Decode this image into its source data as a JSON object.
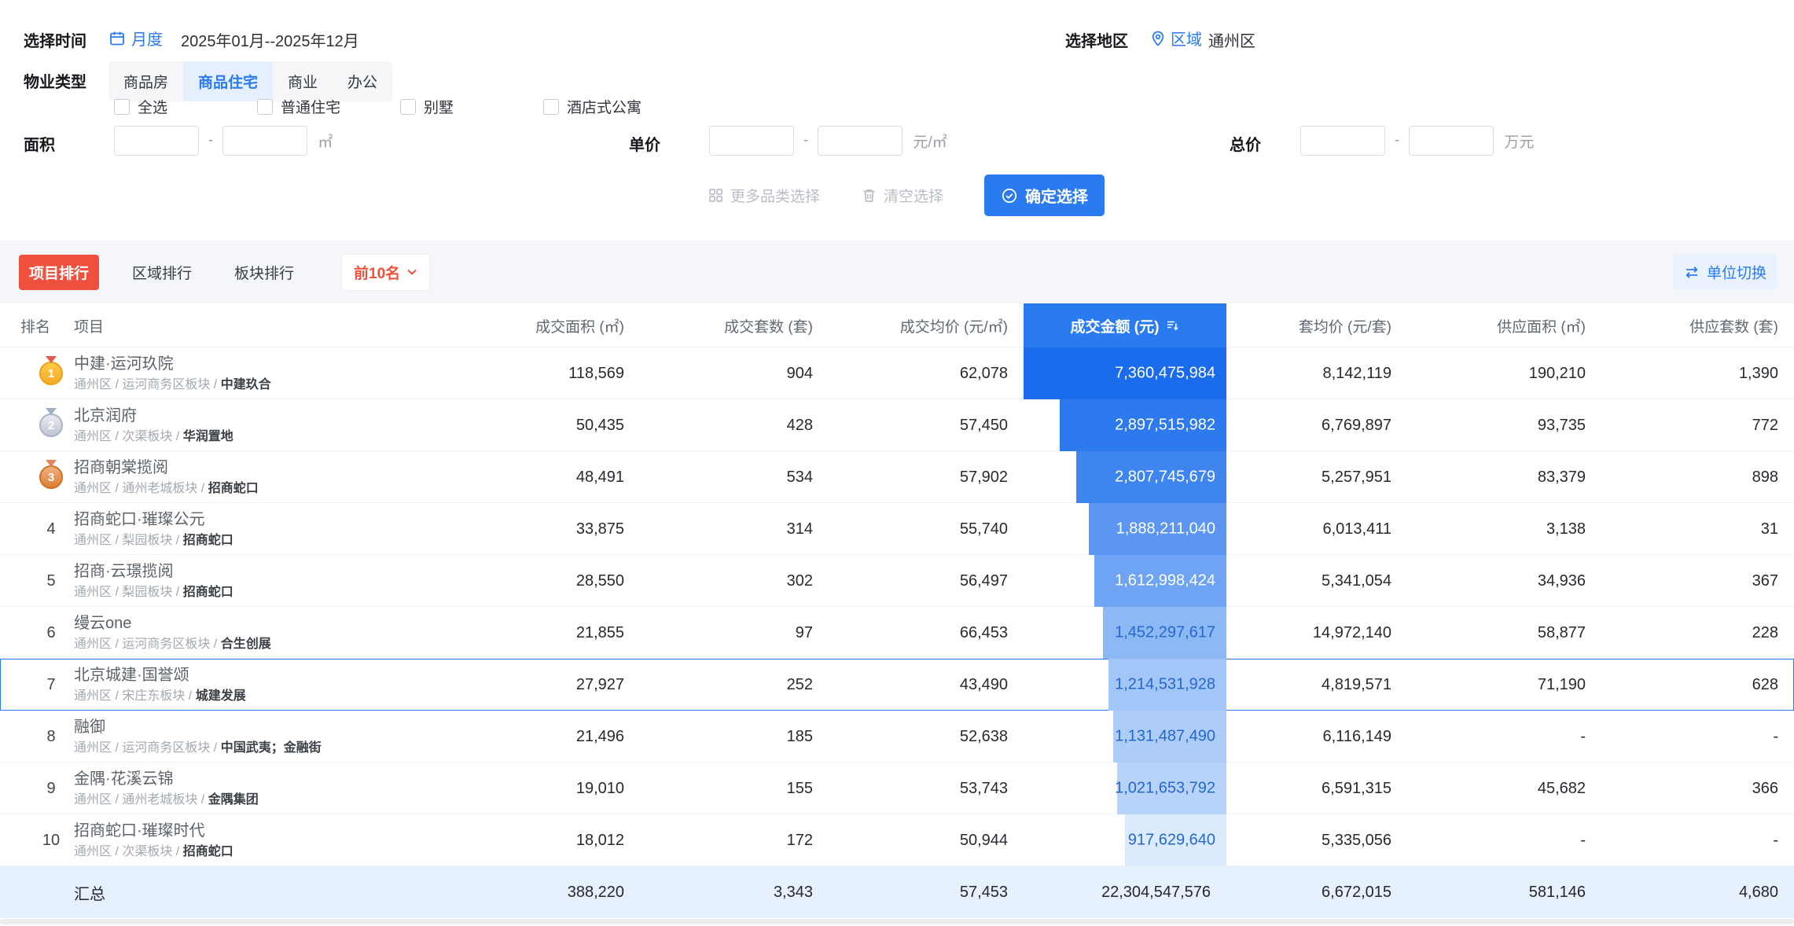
{
  "filters": {
    "time": {
      "label": "选择时间",
      "mode": "月度",
      "range": "2025年01月--2025年12月"
    },
    "region": {
      "label": "选择地区",
      "type": "区域",
      "value": "通州区"
    },
    "property": {
      "label": "物业类型",
      "tabs": [
        {
          "label": "商品房",
          "active": false
        },
        {
          "label": "商品住宅",
          "active": true
        },
        {
          "label": "商业",
          "active": false
        },
        {
          "label": "办公",
          "active": false
        }
      ]
    },
    "subtypes": [
      {
        "label": "全选",
        "checked": false
      },
      {
        "label": "普通住宅",
        "checked": false
      },
      {
        "label": "别墅",
        "checked": false
      },
      {
        "label": "酒店式公寓",
        "checked": false
      }
    ],
    "range_separator": "-",
    "area": {
      "label": "面积",
      "unit": "㎡",
      "min": "",
      "max": ""
    },
    "unit_price": {
      "label": "单价",
      "unit": "元/㎡",
      "min": "",
      "max": ""
    },
    "total_price": {
      "label": "总价",
      "unit": "万元",
      "min": "",
      "max": ""
    },
    "actions": {
      "more": "更多品类选择",
      "clear": "清空选择",
      "confirm": "确定选择"
    }
  },
  "ranking": {
    "tabs": [
      {
        "label": "项目排行",
        "active": true
      },
      {
        "label": "区域排行",
        "active": false
      },
      {
        "label": "板块排行",
        "active": false
      }
    ],
    "top_n": "前10名",
    "unit_switch": "单位切换"
  },
  "table": {
    "headers": [
      "排名",
      "项目",
      "成交面积 (㎡)",
      "成交套数 (套)",
      "成交均价 (元/㎡)",
      "成交金额 (元)",
      "套均价 (元/套)",
      "供应面积 (㎡)",
      "供应套数 (套)"
    ],
    "rows": [
      {
        "rank": "1",
        "medal": "gold",
        "name": "中建·运河玖院",
        "location": "通州区 / 运河商务区板块",
        "developer": "中建玖合",
        "deal_area": "118,569",
        "deal_units": "904",
        "deal_avg_price": "62,078",
        "deal_amount": "7,360,475,984",
        "bar_pct": 100,
        "bar_color": "#1b6cec",
        "bar_text_color": "#ffffff",
        "unit_avg_price": "8,142,119",
        "supply_area": "190,210",
        "supply_units": "1,390",
        "highlighted": false
      },
      {
        "rank": "2",
        "medal": "silver",
        "name": "北京润府",
        "location": "通州区 / 次渠板块",
        "developer": "华润置地",
        "deal_area": "50,435",
        "deal_units": "428",
        "deal_avg_price": "57,450",
        "deal_amount": "2,897,515,982",
        "bar_pct": 82,
        "bar_color": "#2d79ee",
        "bar_text_color": "#ffffff",
        "unit_avg_price": "6,769,897",
        "supply_area": "93,735",
        "supply_units": "772",
        "highlighted": false
      },
      {
        "rank": "3",
        "medal": "bronze",
        "name": "招商朝棠揽阅",
        "location": "通州区 / 通州老城板块",
        "developer": "招商蛇口",
        "deal_area": "48,491",
        "deal_units": "534",
        "deal_avg_price": "57,902",
        "deal_amount": "2,807,745,679",
        "bar_pct": 74,
        "bar_color": "#3f85f0",
        "bar_text_color": "#ffffff",
        "unit_avg_price": "5,257,951",
        "supply_area": "83,379",
        "supply_units": "898",
        "highlighted": false
      },
      {
        "rank": "4",
        "medal": null,
        "name": "招商蛇口·璀璨公元",
        "location": "通州区 / 梨园板块",
        "developer": "招商蛇口",
        "deal_area": "33,875",
        "deal_units": "314",
        "deal_avg_price": "55,740",
        "deal_amount": "1,888,211,040",
        "bar_pct": 68,
        "bar_color": "#5b97f2",
        "bar_text_color": "#ffffff",
        "unit_avg_price": "6,013,411",
        "supply_area": "3,138",
        "supply_units": "31",
        "highlighted": false
      },
      {
        "rank": "5",
        "medal": null,
        "name": "招商·云璟揽阅",
        "location": "通州区 / 梨园板块",
        "developer": "招商蛇口",
        "deal_area": "28,550",
        "deal_units": "302",
        "deal_avg_price": "56,497",
        "deal_amount": "1,612,998,424",
        "bar_pct": 65,
        "bar_color": "#6ea4f3",
        "bar_text_color": "#ffffff",
        "unit_avg_price": "5,341,054",
        "supply_area": "34,936",
        "supply_units": "367",
        "highlighted": false
      },
      {
        "rank": "6",
        "medal": null,
        "name": "缦云one",
        "location": "通州区 / 运河商务区板块",
        "developer": "合生创展",
        "deal_area": "21,855",
        "deal_units": "97",
        "deal_avg_price": "66,453",
        "deal_amount": "1,452,297,617",
        "bar_pct": 61,
        "bar_color": "#8cb9f6",
        "bar_text_color": "#2468cf",
        "unit_avg_price": "14,972,140",
        "supply_area": "58,877",
        "supply_units": "228",
        "highlighted": false
      },
      {
        "rank": "7",
        "medal": null,
        "name": "北京城建·国誉颂",
        "location": "通州区 / 宋庄东板块",
        "developer": "城建发展",
        "deal_area": "27,927",
        "deal_units": "252",
        "deal_avg_price": "43,490",
        "deal_amount": "1,214,531,928",
        "bar_pct": 58,
        "bar_color": "#a3c6f8",
        "bar_text_color": "#2468cf",
        "unit_avg_price": "4,819,571",
        "supply_area": "71,190",
        "supply_units": "628",
        "highlighted": true
      },
      {
        "rank": "8",
        "medal": null,
        "name": "融御",
        "location": "通州区 / 运河商务区板块",
        "developer": "中国武夷；金融街",
        "deal_area": "21,496",
        "deal_units": "185",
        "deal_avg_price": "52,638",
        "deal_amount": "1,131,487,490",
        "bar_pct": 56,
        "bar_color": "#adcdf8",
        "bar_text_color": "#2468cf",
        "unit_avg_price": "6,116,149",
        "supply_area": "-",
        "supply_units": "-",
        "highlighted": false
      },
      {
        "rank": "9",
        "medal": null,
        "name": "金隅·花溪云锦",
        "location": "通州区 / 通州老城板块",
        "developer": "金隅集团",
        "deal_area": "19,010",
        "deal_units": "155",
        "deal_avg_price": "53,743",
        "deal_amount": "1,021,653,792",
        "bar_pct": 54,
        "bar_color": "#b7d3f9",
        "bar_text_color": "#2468cf",
        "unit_avg_price": "6,591,315",
        "supply_area": "45,682",
        "supply_units": "366",
        "highlighted": false
      },
      {
        "rank": "10",
        "medal": null,
        "name": "招商蛇口·璀璨时代",
        "location": "通州区 / 次渠板块",
        "developer": "招商蛇口",
        "deal_area": "18,012",
        "deal_units": "172",
        "deal_avg_price": "50,944",
        "deal_amount": "917,629,640",
        "bar_pct": 50,
        "bar_color": "#dbeafd",
        "bar_text_color": "#2468cf",
        "unit_avg_price": "5,335,056",
        "supply_area": "-",
        "supply_units": "-",
        "highlighted": false
      }
    ],
    "summary": {
      "label": "汇总",
      "deal_area": "388,220",
      "deal_units": "3,343",
      "deal_avg_price": "57,453",
      "deal_amount": "22,304,547,576",
      "unit_avg_price": "6,672,015",
      "supply_area": "581,146",
      "supply_units": "4,680"
    }
  },
  "colors": {
    "accent": "#2a7bf0",
    "rank_tab_active": "#f0513c",
    "amount_header_bg": "#2a7bf0",
    "summary_bg": "#e7f1fd"
  }
}
